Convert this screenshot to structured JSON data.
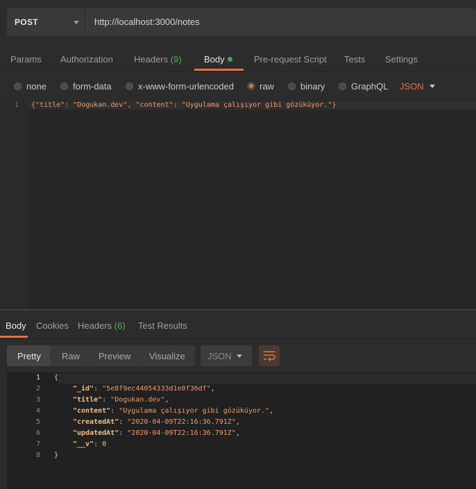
{
  "request": {
    "method": "POST",
    "url": "http://localhost:3000/notes"
  },
  "request_tabs": [
    {
      "label": "Params"
    },
    {
      "label": "Authorization"
    },
    {
      "label": "Headers",
      "count": "(9)"
    },
    {
      "label": "Body"
    },
    {
      "label": "Pre-request Script"
    },
    {
      "label": "Tests"
    },
    {
      "label": "Settings"
    }
  ],
  "body_modes": [
    {
      "label": "none",
      "selected": false
    },
    {
      "label": "form-data",
      "selected": false
    },
    {
      "label": "x-www-form-urlencoded",
      "selected": false
    },
    {
      "label": "raw",
      "selected": true
    },
    {
      "label": "binary",
      "selected": false
    },
    {
      "label": "GraphQL",
      "selected": false
    }
  ],
  "body_format": "JSON",
  "editor": {
    "line_number": "1",
    "content": "{\"title\": \"Dogukan.dev\", \"content\": \"Uygulama çalışıyor gibi gözüküyor.\"}"
  },
  "response_tabs": [
    {
      "label": "Body"
    },
    {
      "label": "Cookies"
    },
    {
      "label": "Headers",
      "count": "(6)"
    },
    {
      "label": "Test Results"
    }
  ],
  "view_modes": [
    "Pretty",
    "Raw",
    "Preview",
    "Visualize"
  ],
  "response_format": "JSON",
  "response_lines": [
    {
      "n": "1",
      "text": "{"
    },
    {
      "n": "2",
      "key": "\"_id\"",
      "value": "\"5e8f9ec44054333d1e0f36df\"",
      "type": "string",
      "comma": ","
    },
    {
      "n": "3",
      "key": "\"title\"",
      "value": "\"Dogukan.dev\"",
      "type": "string",
      "comma": ","
    },
    {
      "n": "4",
      "key": "\"content\"",
      "value": "\"Uygulama çalışıyor gibi gözüküyor.\"",
      "type": "string",
      "comma": ","
    },
    {
      "n": "5",
      "key": "\"createdAt\"",
      "value": "\"2020-04-09T22:16:36.791Z\"",
      "type": "string",
      "comma": ","
    },
    {
      "n": "6",
      "key": "\"updatedAt\"",
      "value": "\"2020-04-09T22:16:36.791Z\"",
      "type": "string",
      "comma": ","
    },
    {
      "n": "7",
      "key": "\"__v\"",
      "value": "0",
      "type": "number",
      "comma": ""
    },
    {
      "n": "8",
      "text": "}"
    }
  ],
  "colors": {
    "accent": "#e8703c",
    "success": "#5fa85b"
  }
}
